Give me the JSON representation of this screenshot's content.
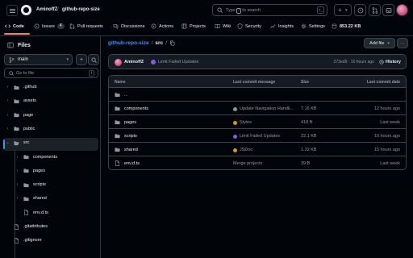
{
  "header": {
    "owner": "AminoffZ",
    "repo": "github-repo-size",
    "search_placeholder_pre": "Type ",
    "search_placeholder_key": "/",
    "search_placeholder_post": " to search",
    "cmd_glyph": ">_",
    "new_glyph": "+",
    "new_caret": "▾"
  },
  "tabs": [
    {
      "label": "Code",
      "icon": "code-icon"
    },
    {
      "label": "Issues",
      "icon": "issues-icon",
      "count": "4"
    },
    {
      "label": "Pull requests",
      "icon": "pull-request-icon"
    },
    {
      "label": "Discussions",
      "icon": "discussions-icon"
    },
    {
      "label": "Actions",
      "icon": "actions-icon"
    },
    {
      "label": "Projects",
      "icon": "projects-icon"
    },
    {
      "label": "Wiki",
      "icon": "wiki-icon"
    },
    {
      "label": "Security",
      "icon": "shield-icon"
    },
    {
      "label": "Insights",
      "icon": "insights-icon"
    },
    {
      "label": "Settings",
      "icon": "gear-icon"
    },
    {
      "label": "853.22 KB",
      "icon": "database-icon"
    }
  ],
  "sidebar": {
    "title": "Files",
    "branch": "main",
    "caret": "▾",
    "add_glyph": "+",
    "search_placeholder": "Go to file",
    "search_key": "t",
    "tree": [
      {
        "label": ".github",
        "type": "folder",
        "level": 0,
        "chevron": "›"
      },
      {
        "label": "assets",
        "type": "folder",
        "level": 0,
        "chevron": "›"
      },
      {
        "label": "page",
        "type": "folder",
        "level": 0,
        "chevron": "›"
      },
      {
        "label": "public",
        "type": "folder",
        "level": 0,
        "chevron": "›"
      },
      {
        "label": "src",
        "type": "folder-open",
        "level": 0,
        "chevron": "⌄"
      },
      {
        "label": "components",
        "type": "folder",
        "level": 1,
        "chevron": "›"
      },
      {
        "label": "pages",
        "type": "folder",
        "level": 1,
        "chevron": "›"
      },
      {
        "label": "scripts",
        "type": "folder",
        "level": 1,
        "chevron": "›"
      },
      {
        "label": "shared",
        "type": "folder",
        "level": 1,
        "chevron": "›"
      },
      {
        "label": "env.d.ts",
        "type": "file",
        "level": 1,
        "chevron": ""
      },
      {
        "label": ".gitattributes",
        "type": "file",
        "level": 0,
        "chevron": ""
      },
      {
        "label": ".gitignore",
        "type": "file",
        "level": 0,
        "chevron": ""
      }
    ]
  },
  "main": {
    "path_repo": "github-repo-size",
    "path_sep": "/",
    "path_current": "src",
    "path_trailing": "/",
    "add_file": "Add file",
    "add_caret": "▾",
    "more": "···",
    "commit": {
      "user": "AminoffZ",
      "message": "Limit Failed Updates",
      "meta": "273ed9 · 10 hours ago",
      "history": "History"
    },
    "columns": {
      "name": "Name",
      "message": "Last commit message",
      "size": "Size",
      "date": "Last commit date"
    },
    "parent": "..",
    "rows": [
      {
        "name": "components",
        "icon": "folder-icon",
        "message": "Update Navigation Handli...",
        "msg_icon": "#8b949e",
        "size": "7.16 KB",
        "date": "12 hours ago"
      },
      {
        "name": "pages",
        "icon": "folder-icon",
        "message": "Styles",
        "msg_icon": "#d29922",
        "size": "418 B",
        "date": "Last week"
      },
      {
        "name": "scripts",
        "icon": "folder-icon",
        "message": "Limit Failed Updates",
        "msg_icon": "#8957e5",
        "size": "22.1 KB",
        "date": "10 hours ago"
      },
      {
        "name": "shared",
        "icon": "folder-icon",
        "message": "JSDoc",
        "msg_icon": "#d29922",
        "size": "1.32 KB",
        "date": "15 hours ago"
      },
      {
        "name": "env.d.ts",
        "icon": "file-icon",
        "message": "Merge projects",
        "msg_icon": "",
        "size": "39 B",
        "date": "Last week"
      }
    ]
  },
  "colors": {
    "accent_link": "#4493f8",
    "tab_underline": "#f78166",
    "bg": "#010409",
    "panel": "#151b23"
  }
}
